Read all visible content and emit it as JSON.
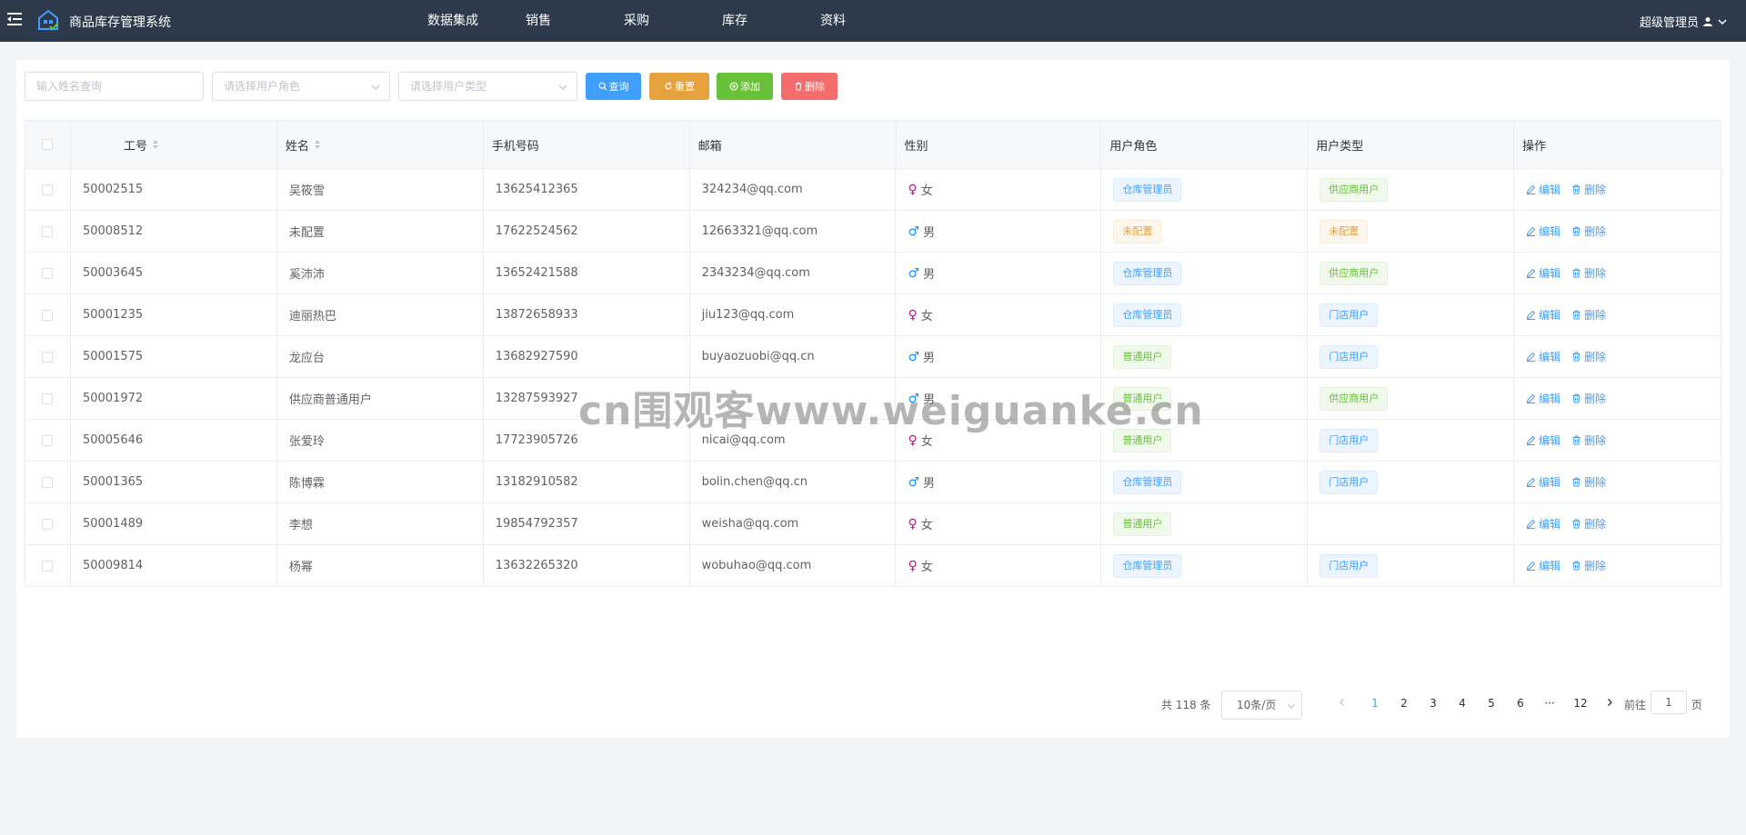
{
  "app": {
    "title": "商品库存管理系统"
  },
  "nav": {
    "items": [
      "数据集成",
      "销售",
      "采购",
      "库存",
      "资料"
    ]
  },
  "user": {
    "name": "超级管理员"
  },
  "toolbar": {
    "name_placeholder": "输入姓名查询",
    "role_placeholder": "请选择用户角色",
    "type_placeholder": "请选择用户类型",
    "query_label": "查询",
    "reset_label": "重置",
    "add_label": "添加",
    "delete_label": "删除"
  },
  "table": {
    "headers": {
      "id": "工号",
      "name": "姓名",
      "phone": "手机号码",
      "email": "邮箱",
      "gender": "性别",
      "role": "用户角色",
      "type": "用户类型",
      "ops": "操作"
    },
    "edit_label": "编辑",
    "delete_label": "删除",
    "rows": [
      {
        "id": "50002515",
        "name": "吴筱雪",
        "phone": "13625412365",
        "email": "324234@qq.com",
        "gender": "女",
        "role": "仓库管理员",
        "type": "供应商用户"
      },
      {
        "id": "50008512",
        "name": "未配置",
        "phone": "17622524562",
        "email": "12663321@qq.com",
        "gender": "男",
        "role": "未配置",
        "type": "未配置"
      },
      {
        "id": "50003645",
        "name": "奚沛沛",
        "phone": "13652421588",
        "email": "2343234@qq.com",
        "gender": "男",
        "role": "仓库管理员",
        "type": "供应商用户"
      },
      {
        "id": "50001235",
        "name": "迪丽热巴",
        "phone": "13872658933",
        "email": "jiu123@qq.com",
        "gender": "女",
        "role": "仓库管理员",
        "type": "门店用户"
      },
      {
        "id": "50001575",
        "name": "龙应台",
        "phone": "13682927590",
        "email": "buyaozuobi@qq.cn",
        "gender": "男",
        "role": "普通用户",
        "type": "门店用户"
      },
      {
        "id": "50001972",
        "name": "供应商普通用户",
        "phone": "13287593927",
        "email": "",
        "gender": "男",
        "role": "普通用户",
        "type": "供应商用户"
      },
      {
        "id": "50005646",
        "name": "张爱玲",
        "phone": "17723905726",
        "email": "nicai@qq.com",
        "gender": "女",
        "role": "普通用户",
        "type": "门店用户"
      },
      {
        "id": "50001365",
        "name": "陈博霖",
        "phone": "13182910582",
        "email": "bolin.chen@qq.cn",
        "gender": "男",
        "role": "仓库管理员",
        "type": "门店用户"
      },
      {
        "id": "50001489",
        "name": "李想",
        "phone": "19854792357",
        "email": "weisha@qq.com",
        "gender": "女",
        "role": "普通用户",
        "type": ""
      },
      {
        "id": "50009814",
        "name": "杨幂",
        "phone": "13632265320",
        "email": "wobuhao@qq.com",
        "gender": "女",
        "role": "仓库管理员",
        "type": "门店用户"
      }
    ]
  },
  "pagination": {
    "total_text": "共 118 条",
    "page_size": "10条/页",
    "pages": [
      "1",
      "2",
      "3",
      "4",
      "5",
      "6",
      "···",
      "12"
    ],
    "current": "1",
    "goto_label": "前往",
    "goto_value": "1",
    "unit": "页"
  },
  "watermark": "cn围观客www.weiguanke.cn",
  "colors": {
    "topbar": "#2d3a4b",
    "primary": "#409eff",
    "warning": "#e6a23c",
    "success": "#67c23a",
    "danger": "#f56c6c",
    "female": "#c71585",
    "male": "#1e90ff"
  }
}
